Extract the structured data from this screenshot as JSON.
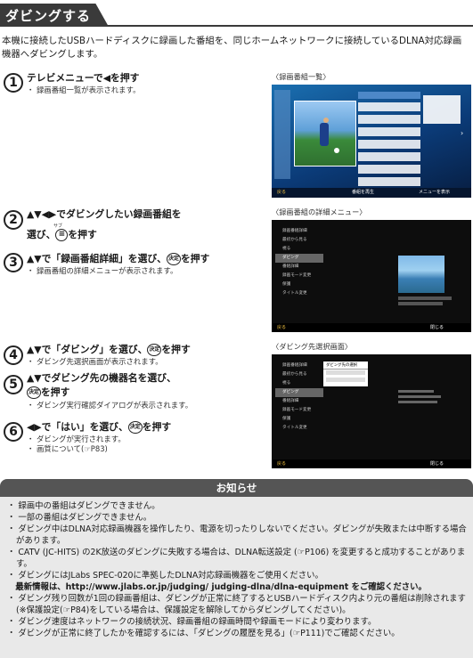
{
  "header": {
    "title": "ダビングする"
  },
  "intro": "本機に接続したUSBハードディスクに録画した番組を、同じホームネットワークに接続しているDLNA対応録画機器へダビングします。",
  "steps": [
    {
      "num": "1",
      "title": "テレビメニューで◀を押す",
      "bullets": [
        "・ 録画番組一覧が表示されます。"
      ]
    },
    {
      "num": "2",
      "title": "▲▼◀▶でダビングしたい録画番組を",
      "title2": "選び、 を押す",
      "ruby": "サブ",
      "bullets": []
    },
    {
      "num": "3",
      "title": "▲▼で「録画番組詳細」を選び、 を押す",
      "bullets": [
        "・ 録画番組の詳細メニューが表示されます。"
      ]
    },
    {
      "num": "4",
      "title": "▲▼で「ダビング」を選び、 を押す",
      "bullets": [
        "・ ダビング先選択画面が表示されます。"
      ]
    },
    {
      "num": "5",
      "title": "▲▼でダビング先の機器名を選び、",
      "title2": " を押す",
      "bullets": [
        "・ ダビング実行確認ダイアログが表示されます。"
      ]
    },
    {
      "num": "6",
      "title": "◀▶で「はい」を選び、 を押す",
      "bullets": [
        "・ ダビングが実行されます。",
        "・ 画質について(☞P83)"
      ]
    }
  ],
  "key_labels": {
    "kettei": "決定",
    "sub": ""
  },
  "captions": [
    "〈録画番組一覧〉",
    "〈録画番組の詳細メニュー〉",
    "〈ダビング先選択画面〉"
  ],
  "screen1": {
    "tag": "番組名 番組名",
    "bottom_left": "戻る",
    "bottom_mid": "番組を再生",
    "bottom_right": "メニューを表示"
  },
  "screen2": {
    "menu": [
      "録画番組詳細",
      "最初から見る",
      "視る",
      "ダビング",
      "番組詳細",
      "録画モード変更",
      "保護",
      "タイトル変更"
    ],
    "bottom_left": "戻る",
    "bottom_right": "閉じる"
  },
  "screen3": {
    "menu": [
      "録画番組詳細",
      "最初から見る",
      "視る",
      "ダビング",
      "番組詳細",
      "録画モード変更",
      "保護",
      "タイトル変更"
    ],
    "dialog_title": "ダビング先の選択",
    "bottom_left": "戻る",
    "bottom_right": "閉じる"
  },
  "notice": {
    "title": "お知らせ",
    "items": [
      "・ 録画中の番組はダビングできません。",
      "・ 一部の番組はダビングできません。",
      "・ ダビング中はDLNA対応録画機器を操作したり、電源を切ったりしないでください。ダビングが失敗または中断する場合があります。",
      "・ CATV (JC-HITS) の2K放送のダビングに失敗する場合は、DLNA転送設定 (☞P106) を変更すると成功することがあります。",
      "・ ダビングにはJLabs SPEC-020に準拠したDLNA対応録画機器をご使用ください。",
      "　最新情報は、http://www.jlabs.or.jp/judging/ judging-dlna/dlna-equipment をご確認ください。",
      "・ ダビング残り回数が1回の録画番組は、ダビングが正常に終了するとUSBハードディスク内より元の番組は削除されます(※保護設定(☞P84)をしている場合は、保護設定を解除してからダビングしてください)。",
      "・ ダビング速度はネットワークの接続状況、録画番組の録画時間や録画モードにより変わります。",
      "・ ダビングが正常に終了したかを確認するには、「ダビングの履歴を見る」(☞P111)でご確認ください。"
    ]
  }
}
